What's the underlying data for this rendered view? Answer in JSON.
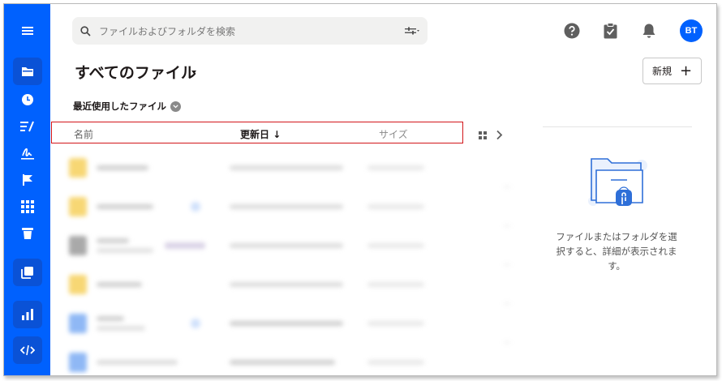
{
  "search": {
    "placeholder": "ファイルおよびフォルダを検索"
  },
  "header": {
    "title": "すべてのファイル",
    "new_button_label": "新規",
    "avatar_initials": "BT"
  },
  "recent": {
    "label": "最近使用したファイル"
  },
  "columns": {
    "name": "名前",
    "modified": "更新日",
    "sort_arrow": "↓",
    "size": "サイズ"
  },
  "details_pane": {
    "empty_message": "ファイルまたはフォルダを選択すると、詳細が表示されます。"
  },
  "colors": {
    "brand_blue": "#0061fe",
    "highlight_border": "#d2151a",
    "folder_yellow": "#f7d774"
  },
  "icons": [
    "menu-icon",
    "folder-icon",
    "clock-icon",
    "list-icon",
    "signature-icon",
    "flag-icon",
    "apps-icon",
    "trash-icon",
    "stack-icon",
    "chart-icon",
    "code-icon",
    "search-icon",
    "filter-icon",
    "help-icon",
    "clipboard-icon",
    "bell-icon",
    "grid-view-icon",
    "chevron-right-icon"
  ]
}
